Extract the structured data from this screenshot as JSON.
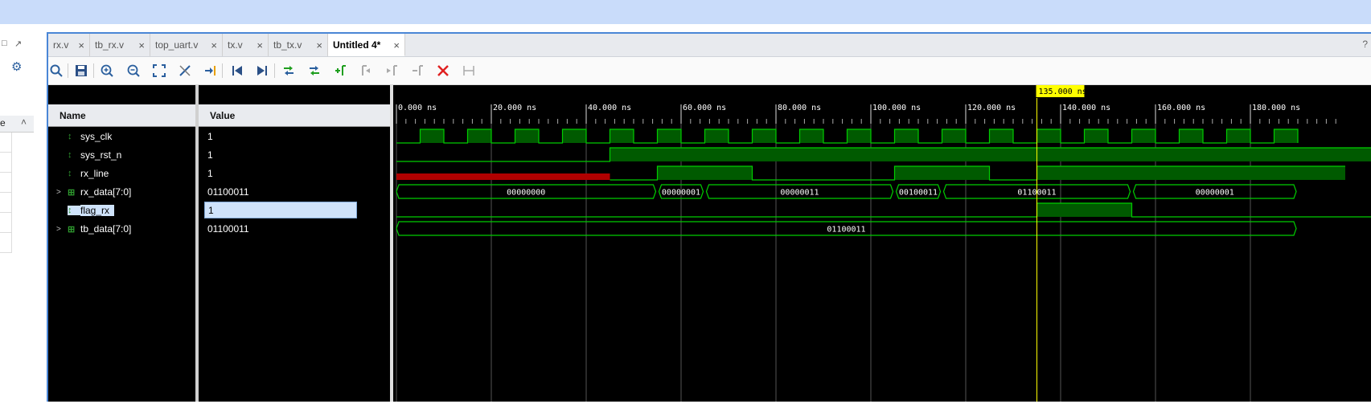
{
  "tabs": [
    {
      "label": "rx.v"
    },
    {
      "label": "tb_rx.v"
    },
    {
      "label": "top_uart.v"
    },
    {
      "label": "tx.v"
    },
    {
      "label": "tb_tx.v"
    },
    {
      "label": "Untitled 4*"
    }
  ],
  "left_panel": {
    "head_label": "e"
  },
  "columns": {
    "name": "Name",
    "value": "Value"
  },
  "signals": [
    {
      "name": "sys_clk",
      "value": "1",
      "type": "bit"
    },
    {
      "name": "sys_rst_n",
      "value": "1",
      "type": "bit"
    },
    {
      "name": "rx_line",
      "value": "1",
      "type": "bit"
    },
    {
      "name": "rx_data[7:0]",
      "value": "01100011",
      "type": "bus"
    },
    {
      "name": "flag_rx",
      "value": "1",
      "type": "bit",
      "selected": true
    },
    {
      "name": "tb_data[7:0]",
      "value": "01100011",
      "type": "bus"
    }
  ],
  "timeline": {
    "cursor_label": "135.000 ns",
    "cursor_time_ns": 135,
    "tick_labels": [
      "0.000 ns",
      "20.000 ns",
      "40.000 ns",
      "60.000 ns",
      "80.000 ns",
      "100.000 ns",
      "120.000 ns",
      "140.000 ns",
      "160.000 ns",
      "180.000 ns"
    ]
  },
  "bus_values": {
    "rx_data": [
      {
        "label": "00000000",
        "start": 0,
        "end": 55
      },
      {
        "label": "00000001",
        "start": 55,
        "end": 65
      },
      {
        "label": "00000011",
        "start": 65,
        "end": 105
      },
      {
        "label": "00100011",
        "start": 105,
        "end": 115
      },
      {
        "label": "01100011",
        "start": 115,
        "end": 155
      },
      {
        "label": "00000001",
        "start": 155,
        "end": 190
      }
    ],
    "tb_data": [
      {
        "label": "01100011",
        "start": 0,
        "end": 190
      }
    ]
  },
  "colors": {
    "wave_green": "#00cc00",
    "fill_green": "#005a00",
    "unknown_red": "#b00000",
    "cursor_bg": "#ffff00"
  }
}
